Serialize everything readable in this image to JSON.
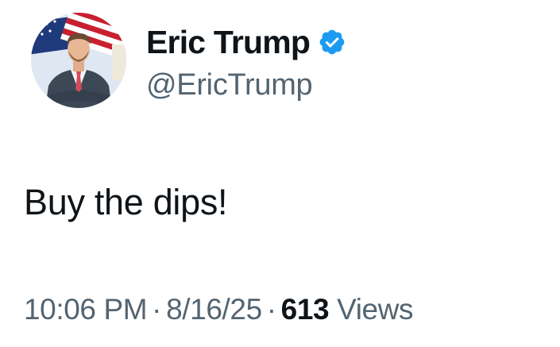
{
  "author": {
    "display_name": "Eric Trump",
    "handle": "@EricTrump",
    "verified": true,
    "verified_color": "#1d9bf0"
  },
  "tweet": {
    "text": "Buy the dips!"
  },
  "meta": {
    "time": "10:06 PM",
    "separator": "·",
    "date": "8/16/25",
    "views_count": "613",
    "views_label": "Views"
  },
  "colors": {
    "primary_text": "#0f1419",
    "secondary_text": "#536471",
    "background": "#ffffff"
  }
}
